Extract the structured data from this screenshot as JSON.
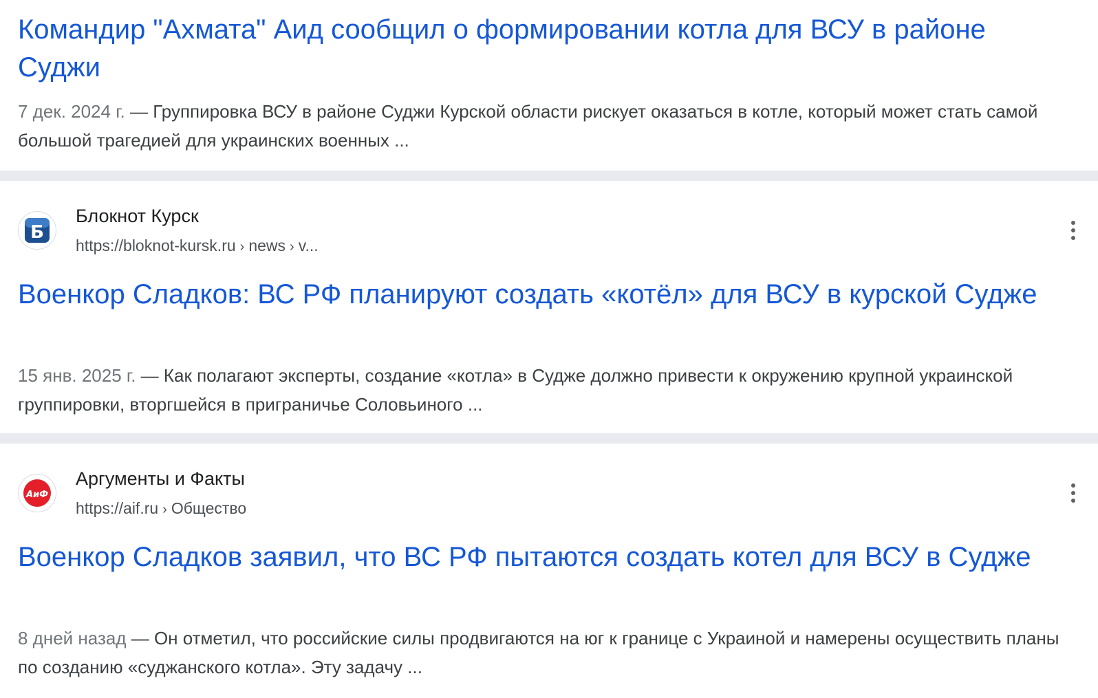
{
  "results": [
    {
      "title": "Командир \"Ахмата\" Аид сообщил о формировании котла для ВСУ в районе Суджи",
      "date": "7 дек. 2024 г.",
      "dash": " — ",
      "snippet": "Группировка ВСУ в районе Суджи Курской области рискует оказаться в котле, который может стать самой большой трагедией для украинских военных ..."
    },
    {
      "source_name": "Блокнот Курск",
      "url_domain": "https://bloknot-kursk.ru",
      "url_path_1": "news",
      "url_path_2": "v...",
      "favicon_letter": "Б",
      "title": "Военкор Сладков: ВС РФ планируют создать «котёл» для ВСУ в курской Судже",
      "date": "15 янв. 2025 г.",
      "dash": " — ",
      "snippet": "Как полагают эксперты, создание «котла» в Судже должно привести к окружению крупной украинской группировки, вторгшейся в приграничье Соловьиного ..."
    },
    {
      "source_name": "Аргументы и Факты",
      "url_domain": "https://aif.ru",
      "url_path_1": "Общество",
      "favicon_letters": "АиФ",
      "title": "Военкор Сладков заявил, что ВС РФ пытаются создать котел для ВСУ в Судже",
      "date": "8 дней назад",
      "dash": " — ",
      "snippet": "Он отметил, что российские силы продвигаются на юг к границе с Украиной и намерены осуществить планы по созданию «суджанского котла». Эту задачу ..."
    }
  ],
  "url_separator": "›",
  "colors": {
    "title_link": "#1558d6",
    "divider": "#e8eaef",
    "bloknot_brand": "#1d4e8f",
    "aif_brand": "#e3202a"
  },
  "icons": {
    "menu": "more-vert-icon"
  }
}
